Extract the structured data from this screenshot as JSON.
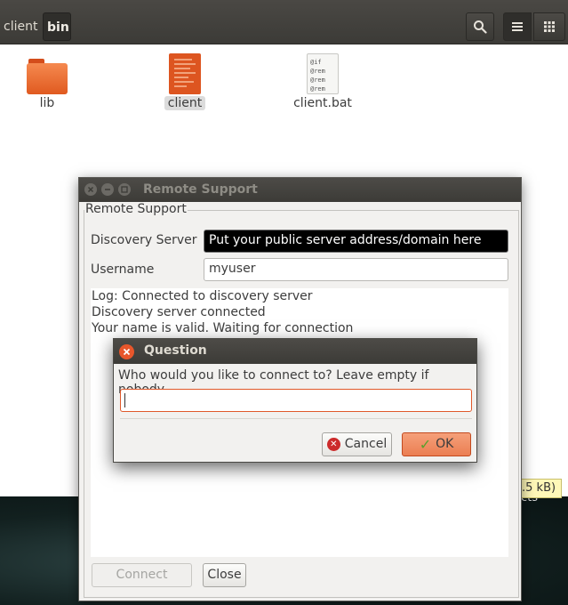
{
  "file_manager": {
    "breadcrumbs": [
      "client",
      "bin"
    ],
    "files": [
      {
        "name": "lib",
        "type": "folder"
      },
      {
        "name": "client",
        "type": "executable"
      },
      {
        "name": "client.bat",
        "type": "batch",
        "preview": [
          "@if",
          "@rem",
          "@rem",
          "@rem"
        ]
      }
    ],
    "status_chip": ".5 kB)"
  },
  "desktop": {
    "label": "cts"
  },
  "remote_support": {
    "title": "Remote Support",
    "group_label": "Remote Support",
    "discovery_server_label": "Discovery Server",
    "discovery_server_value": "Put your public server address/domain here",
    "username_label": "Username",
    "username_value": "myuser",
    "log": [
      "Log: Connected to discovery server",
      "Discovery server connected",
      "Your name is valid. Waiting for connection"
    ],
    "connect_label": "Connect",
    "close_label": "Close"
  },
  "question_dialog": {
    "title": "Question",
    "prompt": "Who would you like to connect to? Leave empty if nobody.",
    "input_value": "",
    "cancel_label": "Cancel",
    "ok_label": "OK"
  }
}
